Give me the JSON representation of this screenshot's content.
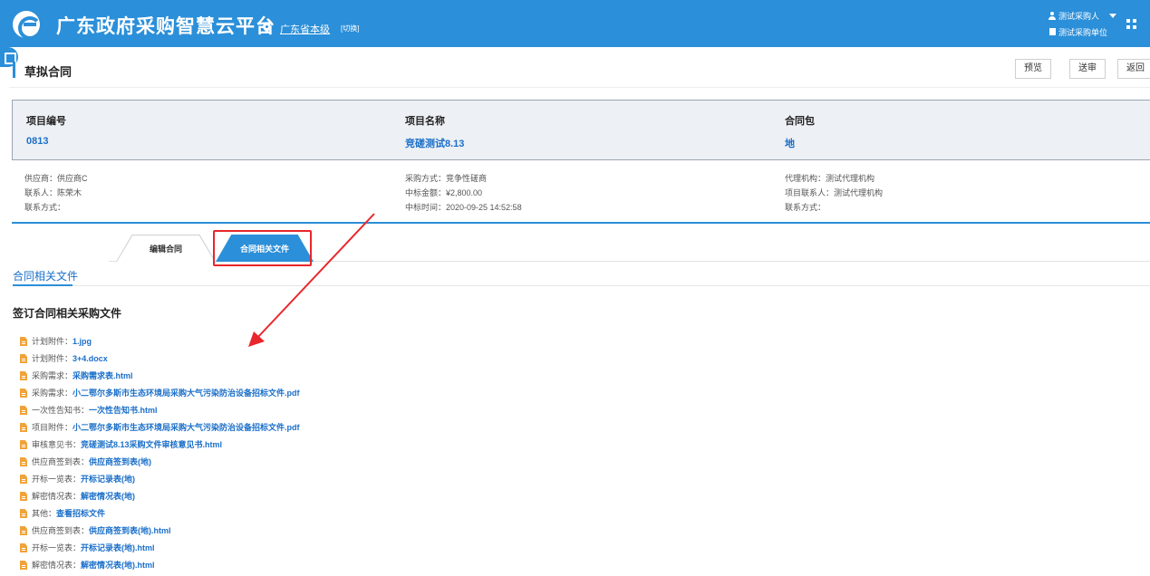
{
  "header": {
    "app_title": "广东政府采购智慧云平台",
    "region": "广东省本级",
    "switch_label": "[切换]",
    "user_name": "测试采购人",
    "unit_name": "测试采购单位"
  },
  "page": {
    "title": "草拟合同",
    "buttons": {
      "preview": "预览",
      "submit": "送审",
      "back": "返回"
    }
  },
  "project": {
    "number_label": "项目编号",
    "number_value": "0813",
    "name_label": "项目名称",
    "name_value": "竞磋测试8.13",
    "package_label": "合同包",
    "package_value": "地"
  },
  "details": {
    "col1": [
      "供应商：供应商C",
      "联系人：陈荣木",
      "联系方式："
    ],
    "col2": [
      "采购方式：竞争性磋商",
      "中标金额：¥2,800.00",
      "中标时间：2020-09-25 14:52:58"
    ],
    "col3": [
      "代理机构：测试代理机构",
      "项目联系人：测试代理机构",
      "联系方式："
    ]
  },
  "tabs": {
    "edit": "编辑合同",
    "files": "合同相关文件"
  },
  "section": {
    "tab_label": "合同相关文件",
    "subtitle": "签订合同相关采购文件"
  },
  "files": [
    {
      "type": "计划附件：",
      "name": "1.jpg"
    },
    {
      "type": "计划附件：",
      "name": "3+4.docx"
    },
    {
      "type": "采购需求：",
      "name": "采购需求表.html"
    },
    {
      "type": "采购需求：",
      "name": "小二鄂尔多斯市生态环境局采购大气污染防治设备招标文件.pdf"
    },
    {
      "type": "一次性告知书：",
      "name": "一次性告知书.html"
    },
    {
      "type": "项目附件：",
      "name": "小二鄂尔多斯市生态环境局采购大气污染防治设备招标文件.pdf"
    },
    {
      "type": "审核意见书：",
      "name": "竞磋测试8.13采购文件审核意见书.html"
    },
    {
      "type": "供应商签到表：",
      "name": "供应商签到表(地)"
    },
    {
      "type": "开标一览表：",
      "name": "开标记录表(地)"
    },
    {
      "type": "解密情况表：",
      "name": "解密情况表(地)"
    },
    {
      "type": "其他：",
      "name": "查看招标文件"
    },
    {
      "type": "供应商签到表：",
      "name": "供应商签到表(地).html"
    },
    {
      "type": "开标一览表：",
      "name": "开标记录表(地).html"
    },
    {
      "type": "解密情况表：",
      "name": "解密情况表(地).html"
    }
  ],
  "colors": {
    "brand": "#2b8fd9",
    "link": "#1a6fc9",
    "annotation": "#e8262b",
    "file_icon": "#f0a33a"
  }
}
